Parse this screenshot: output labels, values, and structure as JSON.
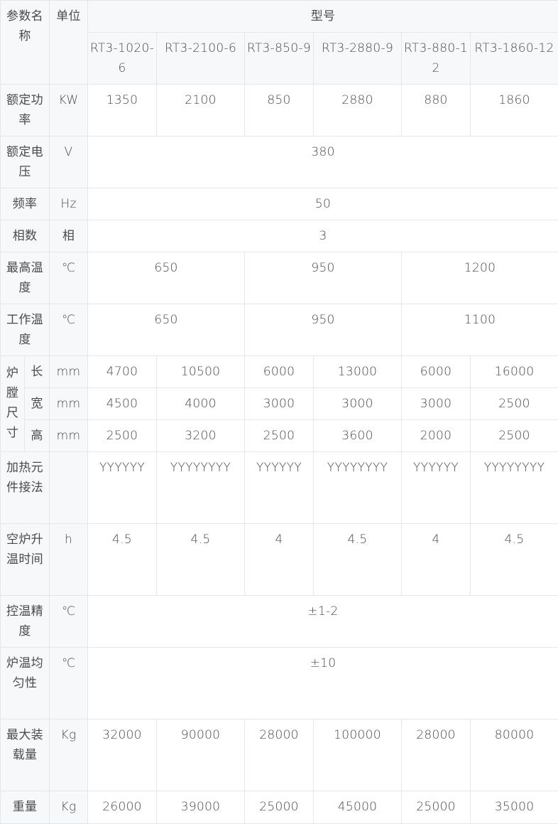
{
  "header": {
    "param_name": "参数名称",
    "unit": "单位",
    "model": "型号",
    "models": [
      "RT3-1020-6",
      "RT3-2100-6",
      "RT3-850-9",
      "RT3-2880-9",
      "RT3-880-12",
      "RT3-1860-12"
    ]
  },
  "rows": {
    "rated_power": {
      "label": "额定功率",
      "unit": "KW",
      "values": [
        "1350",
        "2100",
        "850",
        "2880",
        "880",
        "1860"
      ]
    },
    "rated_voltage": {
      "label": "额定电压",
      "unit": "V",
      "value": "380"
    },
    "frequency": {
      "label": "频率",
      "unit": "Hz",
      "value": "50"
    },
    "phases": {
      "label": "相数",
      "unit": "相",
      "value": "3"
    },
    "max_temp": {
      "label": "最高温度",
      "unit": "℃",
      "values": [
        "650",
        "950",
        "1200"
      ]
    },
    "work_temp": {
      "label": "工作温度",
      "unit": "℃",
      "values": [
        "650",
        "950",
        "1100"
      ]
    },
    "chamber": {
      "label": "炉膛尺寸",
      "length": {
        "label": "长",
        "unit": "mm",
        "values": [
          "4700",
          "10500",
          "6000",
          "13000",
          "6000",
          "16000"
        ]
      },
      "width": {
        "label": "宽",
        "unit": "mm",
        "values": [
          "4500",
          "4000",
          "3000",
          "3000",
          "3000",
          "2500"
        ]
      },
      "height": {
        "label": "高",
        "unit": "mm",
        "values": [
          "2500",
          "3200",
          "2500",
          "3600",
          "2000",
          "2500"
        ]
      }
    },
    "heating_connection": {
      "label": "加热元件接法",
      "unit": "",
      "values": [
        "YYYYYY",
        "YYYYYYYY",
        "YYYYYY",
        "YYYYYYYY",
        "YYYYYY",
        "YYYYYYYY"
      ]
    },
    "heatup_time": {
      "label": "空炉升温时间",
      "unit": "h",
      "values": [
        "4.5",
        "4.5",
        "4",
        "4.5",
        "4",
        "4.5"
      ]
    },
    "temp_accuracy": {
      "label": "控温精度",
      "unit": "℃",
      "value": "±1-2"
    },
    "temp_uniformity": {
      "label": "炉温均匀性",
      "unit": "℃",
      "value": "±10"
    },
    "max_load": {
      "label": "最大装载量",
      "unit": "Kg",
      "values": [
        "32000",
        "90000",
        "28000",
        "100000",
        "28000",
        "80000"
      ]
    },
    "weight": {
      "label": "重量",
      "unit": "Kg",
      "values": [
        "26000",
        "39000",
        "25000",
        "45000",
        "25000",
        "35000"
      ]
    }
  }
}
